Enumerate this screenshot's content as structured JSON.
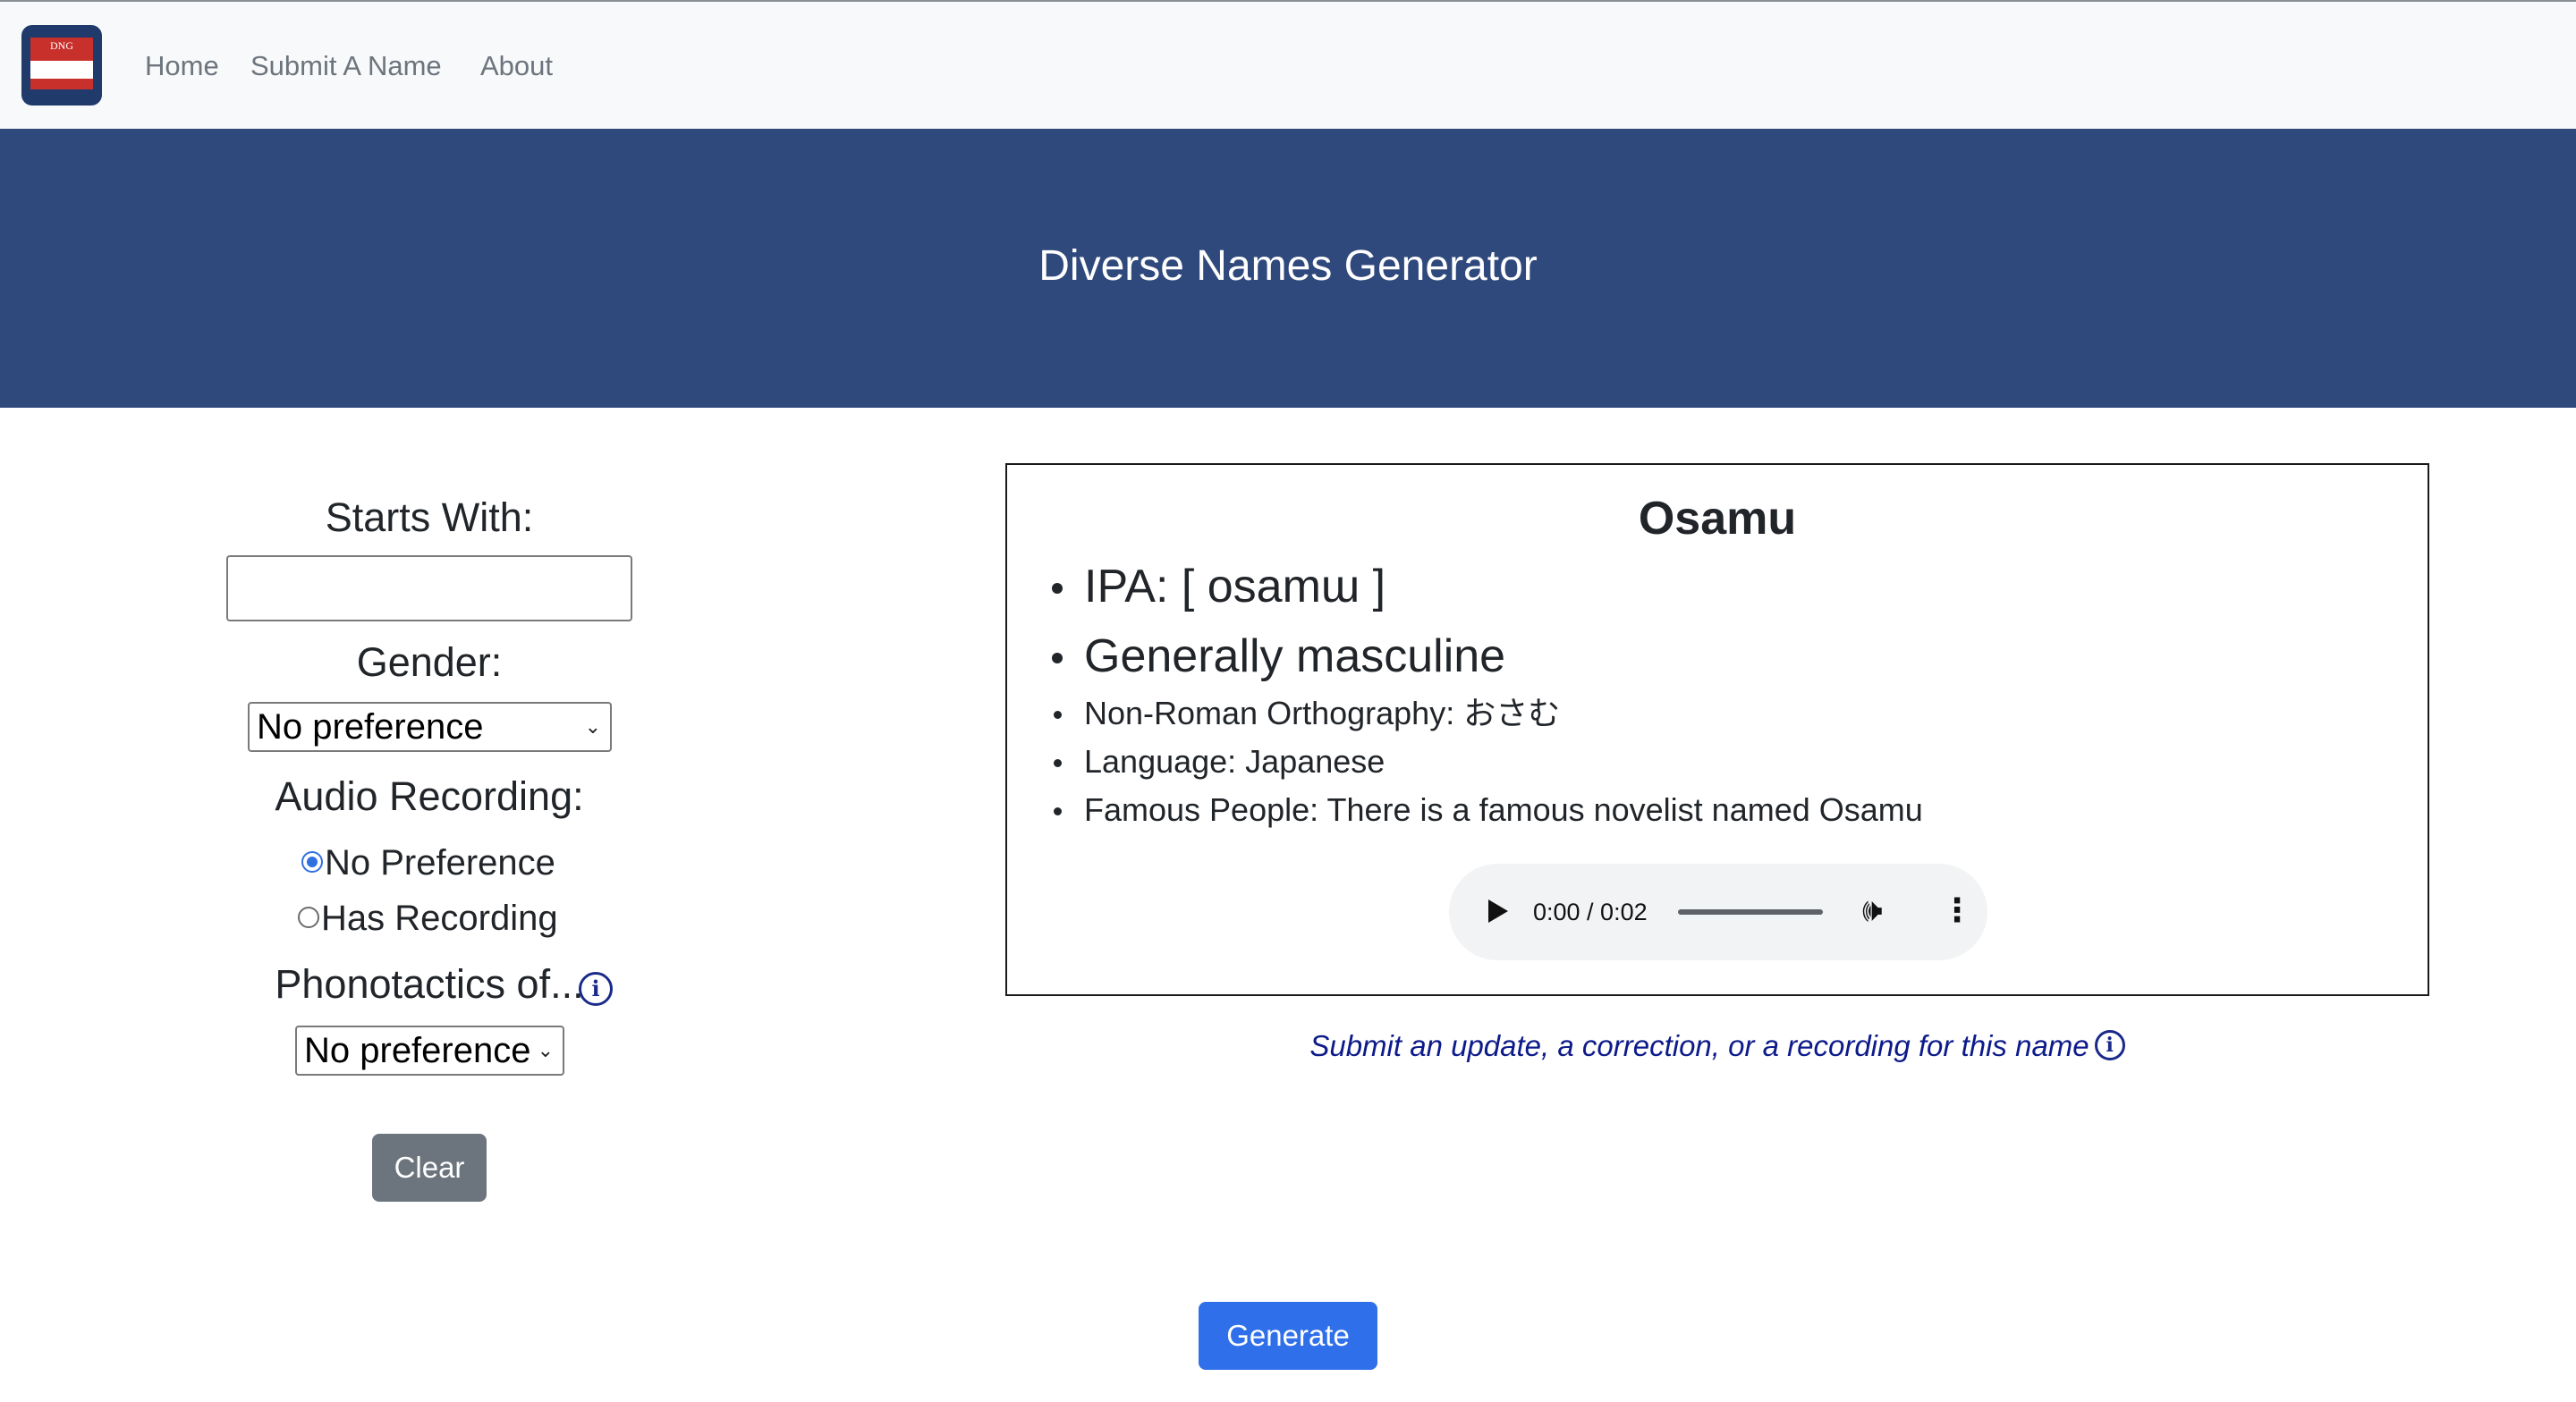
{
  "nav": {
    "logo_text": "DNG",
    "links": [
      {
        "label": "Home"
      },
      {
        "label": "Submit A Name"
      },
      {
        "label": "About"
      }
    ]
  },
  "hero": {
    "title": "Diverse Names Generator"
  },
  "filters": {
    "starts_with_label": "Starts With:",
    "starts_with_value": "",
    "gender_label": "Gender:",
    "gender_selected": "No preference",
    "audio_label": "Audio Recording:",
    "audio_options": [
      {
        "label": "No Preference",
        "checked": true
      },
      {
        "label": "Has Recording",
        "checked": false
      }
    ],
    "phonotactics_label": "Phonotactics of...",
    "phonotactics_selected": "No preference",
    "clear_label": "Clear"
  },
  "result": {
    "name": "Osamu",
    "ipa": "IPA: [ osamɯ ]",
    "gender": "Generally masculine",
    "orthography": "Non-Roman Orthography: おさむ",
    "language": "Language: Japanese",
    "famous": "Famous People: There is a famous novelist named Osamu",
    "audio": {
      "time": "0:00 / 0:02",
      "progress": 0
    }
  },
  "update_link": "Submit an update, a correction, or a recording for this name",
  "generate_label": "Generate",
  "colors": {
    "hero_bg": "#30497d",
    "primary": "#2f6fe9",
    "secondary": "#6c757d",
    "link": "#0d1a8a"
  },
  "icons": {
    "info": "info-circle-icon",
    "play": "play-icon",
    "volume": "volume-icon",
    "more": "more-vert-icon"
  }
}
